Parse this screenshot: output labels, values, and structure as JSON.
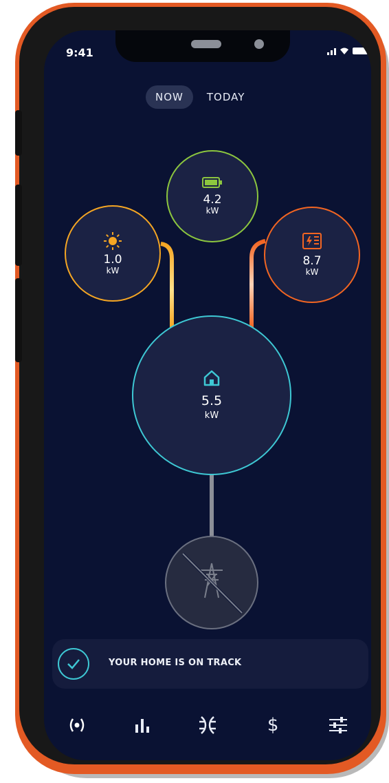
{
  "status_bar": {
    "time": "9:41"
  },
  "tabs": [
    {
      "label": "NOW",
      "active": true
    },
    {
      "label": "TODAY",
      "active": false
    }
  ],
  "nodes": {
    "solar": {
      "icon": "sun-icon",
      "value": "1.0",
      "unit": "kW",
      "color": "#f5a623"
    },
    "battery": {
      "icon": "battery-icon",
      "value": "4.2",
      "unit": "kW",
      "color": "#8cc63f"
    },
    "ev": {
      "icon": "ev-charger-icon",
      "value": "8.7",
      "unit": "kW",
      "color": "#f26522"
    },
    "home": {
      "icon": "home-icon",
      "value": "5.5",
      "unit": "kW",
      "color": "#3ec8d4"
    },
    "grid": {
      "icon": "power-tower-icon",
      "state": "disconnected"
    }
  },
  "status": {
    "icon": "check-icon",
    "text": "YOUR HOME IS ON TRACK"
  },
  "nav": [
    "live-icon",
    "chart-icon",
    "flow-icon",
    "dollar-icon",
    "settings-sliders-icon"
  ],
  "nav_labels": {
    "dollar": "$"
  }
}
